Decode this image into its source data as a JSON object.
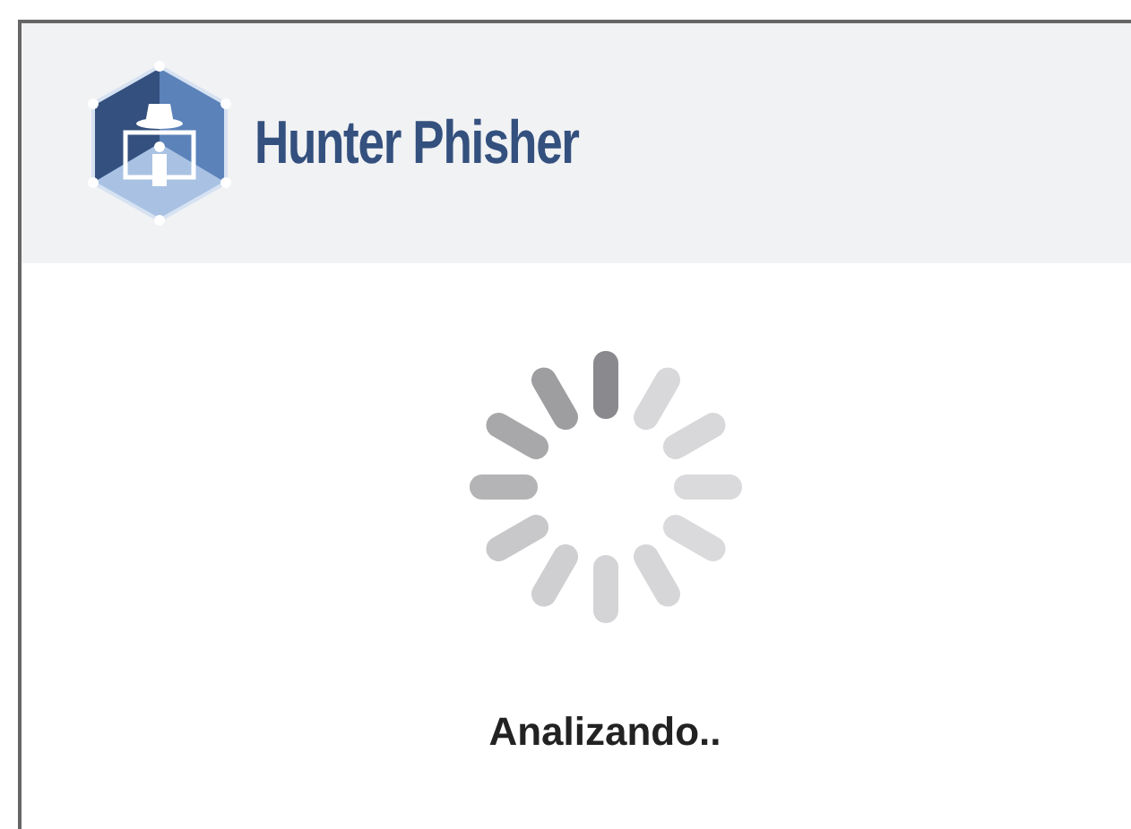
{
  "header": {
    "app_name": "Hunter Phisher"
  },
  "status": {
    "message": "Analizando.."
  }
}
